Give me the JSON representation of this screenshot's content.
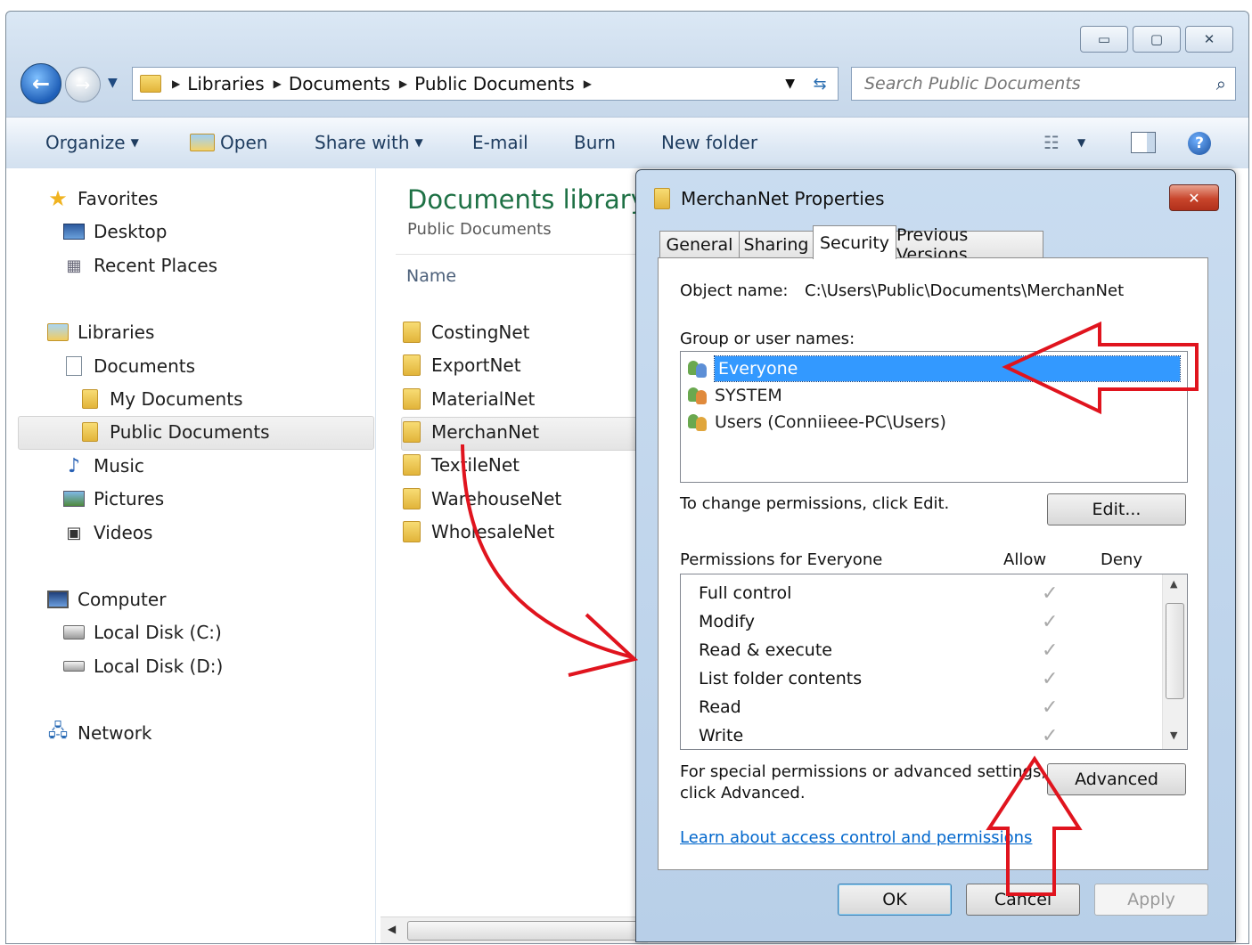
{
  "window": {
    "controls": {
      "minimize": "▭",
      "maximize": "▢",
      "close": "✕"
    }
  },
  "address": {
    "crumbs": [
      "Libraries",
      "Documents",
      "Public Documents"
    ]
  },
  "search": {
    "placeholder": "Search Public Documents"
  },
  "toolbar": {
    "organize": "Organize",
    "open": "Open",
    "share_with": "Share with",
    "email": "E-mail",
    "burn": "Burn",
    "new_folder": "New folder"
  },
  "nav": {
    "favorites": "Favorites",
    "desktop": "Desktop",
    "recent_places": "Recent Places",
    "libraries": "Libraries",
    "documents": "Documents",
    "my_documents": "My Documents",
    "public_documents": "Public Documents",
    "music": "Music",
    "pictures": "Pictures",
    "videos": "Videos",
    "computer": "Computer",
    "local_c": "Local Disk (C:)",
    "local_d": "Local Disk (D:)",
    "network": "Network"
  },
  "content": {
    "library_title": "Documents library",
    "subtitle": "Public Documents",
    "column_name": "Name",
    "files": [
      "CostingNet",
      "ExportNet",
      "MaterialNet",
      "MerchanNet",
      "TextileNet",
      "WarehouseNet",
      "WholesaleNet"
    ]
  },
  "dialog": {
    "title": "MerchanNet Properties",
    "tabs": [
      "General",
      "Sharing",
      "Security",
      "Previous Versions"
    ],
    "object_name_label": "Object name:",
    "object_name_value": "C:\\Users\\Public\\Documents\\MerchanNet",
    "group_label": "Group or user names:",
    "users": [
      "Everyone",
      "SYSTEM",
      "Users (Conniieee-PC\\Users)"
    ],
    "change_text": "To change permissions, click Edit.",
    "edit_button": "Edit...",
    "permissions_for": "Permissions for Everyone",
    "allow": "Allow",
    "deny": "Deny",
    "permissions": [
      "Full control",
      "Modify",
      "Read & execute",
      "List folder contents",
      "Read",
      "Write"
    ],
    "advanced_text_1": "For special permissions or advanced settings,",
    "advanced_text_2": "click Advanced.",
    "advanced_button": "Advanced",
    "learn_link": "Learn about access control and permissions",
    "ok": "OK",
    "cancel": "Cancel",
    "apply": "Apply"
  },
  "colors": {
    "selection": "#3399ff",
    "annotation_red": "#e0141e",
    "link": "#0066cc",
    "library_title": "#1e7145"
  }
}
